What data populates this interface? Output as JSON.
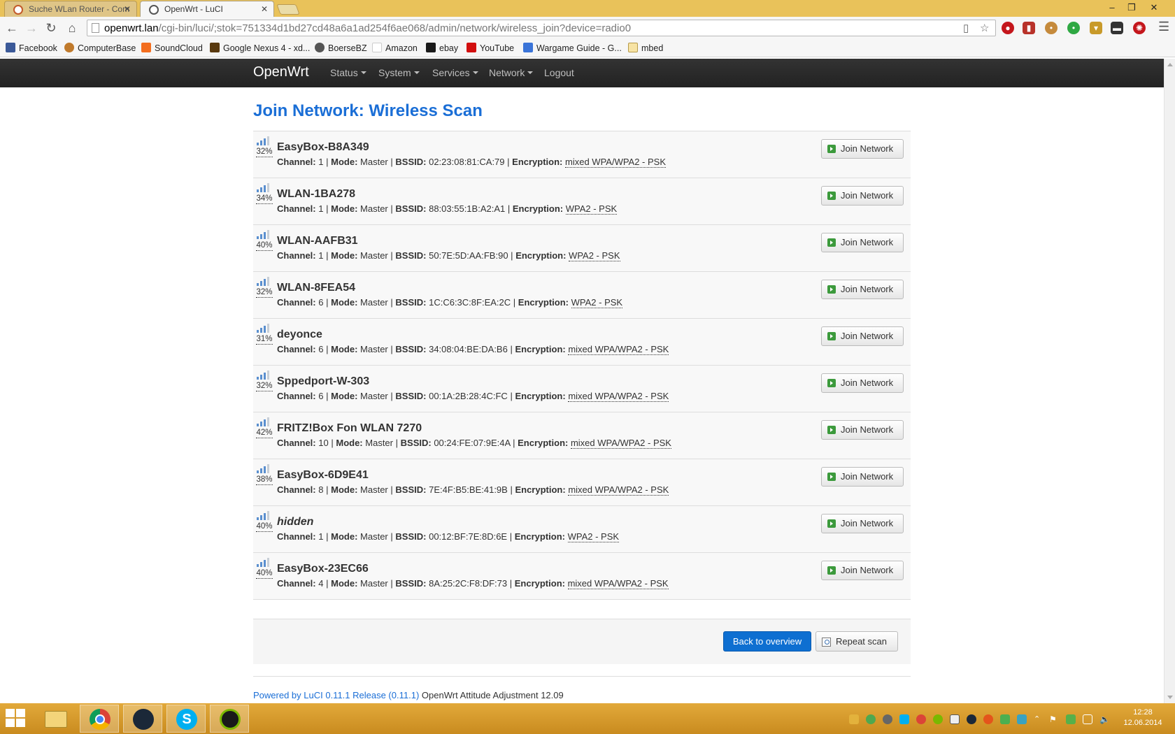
{
  "browser": {
    "tabs": [
      {
        "title": "Suche WLan Router - Com",
        "active": false
      },
      {
        "title": "OpenWrt - LuCI",
        "active": true
      }
    ],
    "url_host": "openwrt.lan",
    "url_path": "/cgi-bin/luci/;stok=751334d1bd27cd48a6a1ad254f6ae068/admin/network/wireless_join?device=radio0",
    "bookmarks": [
      "Facebook",
      "ComputerBase",
      "SoundCloud",
      "Google Nexus 4 - xd...",
      "BoerseBZ",
      "Amazon",
      "ebay",
      "YouTube",
      "Wargame Guide - G...",
      "mbed"
    ]
  },
  "nav": {
    "brand": "OpenWrt",
    "menus": [
      "Status",
      "System",
      "Services",
      "Network"
    ],
    "logout": "Logout"
  },
  "page": {
    "title": "Join Network: Wireless Scan"
  },
  "labels": {
    "channel": "Channel:",
    "mode": "Mode:",
    "bssid": "BSSID:",
    "encryption": "Encryption:",
    "sep": "|",
    "join": "Join Network"
  },
  "networks": [
    {
      "ssid": "EasyBox-B8A349",
      "signal": "32%",
      "channel": "1",
      "mode": "Master",
      "bssid": "02:23:08:81:CA:79",
      "encryption": "mixed WPA/WPA2 - PSK"
    },
    {
      "ssid": "WLAN-1BA278",
      "signal": "34%",
      "channel": "1",
      "mode": "Master",
      "bssid": "88:03:55:1B:A2:A1",
      "encryption": "WPA2 - PSK"
    },
    {
      "ssid": "WLAN-AAFB31",
      "signal": "40%",
      "channel": "1",
      "mode": "Master",
      "bssid": "50:7E:5D:AA:FB:90",
      "encryption": "WPA2 - PSK"
    },
    {
      "ssid": "WLAN-8FEA54",
      "signal": "32%",
      "channel": "6",
      "mode": "Master",
      "bssid": "1C:C6:3C:8F:EA:2C",
      "encryption": "WPA2 - PSK"
    },
    {
      "ssid": "deyonce",
      "signal": "31%",
      "channel": "6",
      "mode": "Master",
      "bssid": "34:08:04:BE:DA:B6",
      "encryption": "mixed WPA/WPA2 - PSK"
    },
    {
      "ssid": "Sppedport-W-303",
      "signal": "32%",
      "channel": "6",
      "mode": "Master",
      "bssid": "00:1A:2B:28:4C:FC",
      "encryption": "mixed WPA/WPA2 - PSK"
    },
    {
      "ssid": "FRITZ!Box Fon WLAN 7270",
      "signal": "42%",
      "channel": "10",
      "mode": "Master",
      "bssid": "00:24:FE:07:9E:4A",
      "encryption": "mixed WPA/WPA2 - PSK"
    },
    {
      "ssid": "EasyBox-6D9E41",
      "signal": "38%",
      "channel": "8",
      "mode": "Master",
      "bssid": "7E:4F:B5:BE:41:9B",
      "encryption": "mixed WPA/WPA2 - PSK"
    },
    {
      "ssid": "hidden",
      "signal": "40%",
      "channel": "1",
      "mode": "Master",
      "bssid": "00:12:BF:7E:8D:6E",
      "encryption": "WPA2 - PSK"
    },
    {
      "ssid": "EasyBox-23EC66",
      "signal": "40%",
      "channel": "4",
      "mode": "Master",
      "bssid": "8A:25:2C:F8:DF:73",
      "encryption": "mixed WPA/WPA2 - PSK"
    }
  ],
  "actions": {
    "back": "Back to overview",
    "repeat": "Repeat scan"
  },
  "footer": {
    "link": "Powered by LuCI 0.11.1 Release (0.11.1)",
    "text": "OpenWrt Attitude Adjustment 12.09"
  },
  "taskbar": {
    "time": "12:28",
    "date": "12.06.2014"
  }
}
